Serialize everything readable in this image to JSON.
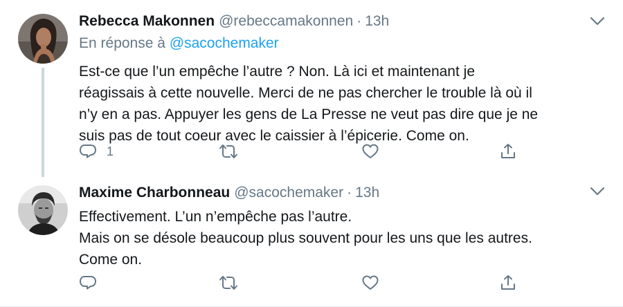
{
  "tweets": [
    {
      "author": {
        "name": "Rebecca Makonnen",
        "handle": "@rebeccamakonnen",
        "avatar_icon": "person-avatar-woman"
      },
      "time": "13h",
      "separator": "·",
      "reply_to": {
        "prefix": "En réponse à",
        "mention": "@sacochemaker"
      },
      "text_lines": [
        "Est-ce que l’un empêche l’autre ? Non. Là ici et maintenant je",
        "réagissais à cette nouvelle. Merci de ne pas chercher le trouble là où il",
        "n’y en a pas. Appuyer les gens de La Presse ne veut pas dire que je ne",
        "suis pas de tout coeur avec le caissier à l’épicerie. Come on."
      ],
      "reply_count": "1"
    },
    {
      "author": {
        "name": "Maxime Charbonneau",
        "handle": "@sacochemaker",
        "avatar_icon": "person-avatar-man"
      },
      "time": "13h",
      "separator": "·",
      "text_lines": [
        "Effectivement. L’un n’empêche pas l’autre.",
        "Mais on se désole beaucoup plus souvent pour les uns que les autres.",
        "Come on."
      ]
    }
  ],
  "colors": {
    "text_primary": "#14171a",
    "text_secondary": "#657786",
    "link_blue": "#1da1f2",
    "thread_line": "#ccd6dd",
    "divider": "#e6ecf0"
  },
  "icons": [
    "chevron-down-icon",
    "reply-icon",
    "retweet-icon",
    "like-icon",
    "share-icon"
  ]
}
